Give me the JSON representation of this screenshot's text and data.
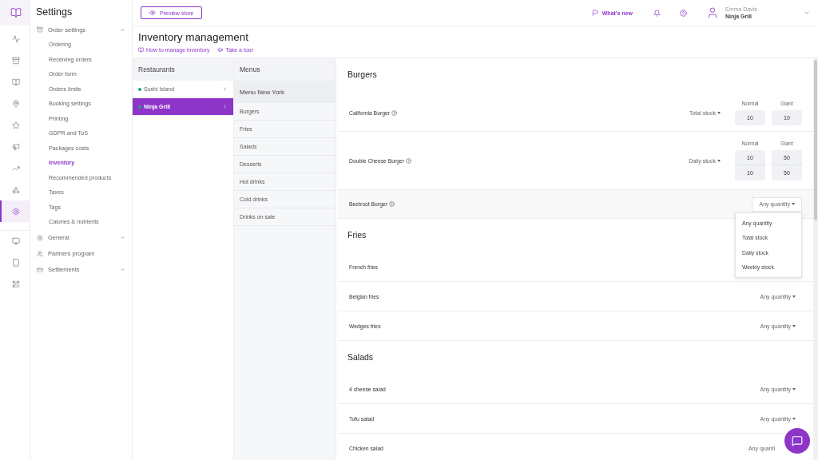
{
  "rail": [
    {
      "selected": false
    },
    {
      "selected": false
    },
    {
      "selected": false
    },
    {
      "selected": false
    },
    {
      "selected": false
    },
    {
      "selected": false
    },
    {
      "selected": false
    },
    {
      "selected": false
    },
    {
      "selected": false
    },
    {
      "selected": true
    },
    {
      "selected": false
    },
    {
      "selected": false
    },
    {
      "selected": false
    }
  ],
  "settings": {
    "title": "Settings",
    "groups": [
      {
        "label": "Order settings",
        "expandable": true,
        "expanded": true,
        "children": [
          {
            "label": "Ordering",
            "selected": false
          },
          {
            "label": "Receiving orders",
            "selected": false
          },
          {
            "label": "Order form",
            "selected": false
          },
          {
            "label": "Orders limits",
            "selected": false
          },
          {
            "label": "Booking settings",
            "selected": false
          },
          {
            "label": "Printing",
            "selected": false
          },
          {
            "label": "GDPR and ToS",
            "selected": false
          },
          {
            "label": "Packages costs",
            "selected": false
          },
          {
            "label": "Inventory",
            "selected": true
          },
          {
            "label": "Recommended products",
            "selected": false
          },
          {
            "label": "Taxes",
            "selected": false
          },
          {
            "label": "Tags",
            "selected": false
          },
          {
            "label": "Calories & nutrients",
            "selected": false
          }
        ]
      },
      {
        "label": "General",
        "expandable": true,
        "expanded": false
      },
      {
        "label": "Partners program",
        "expandable": false,
        "expanded": false
      },
      {
        "label": "Settlements",
        "expandable": true,
        "expanded": false
      }
    ]
  },
  "header": {
    "preview_button": "Preview store",
    "whats_new": "What's new",
    "user": {
      "name": "Emma Davis",
      "restaurant": "Ninja Grill"
    }
  },
  "page": {
    "title": "Inventory management",
    "links": [
      "How to manage inventory",
      "Take a tour"
    ]
  },
  "restaurants": {
    "title": "Restaurants",
    "items": [
      {
        "name": "Sushi Island",
        "color": "#1aa37a",
        "selected": false
      },
      {
        "name": "Ninja Grill",
        "color": "#1aa37a",
        "selected": true
      }
    ]
  },
  "menus": {
    "title": "Menus",
    "menu": "Menu New York",
    "categories": [
      "Burgers",
      "Fries",
      "Salads",
      "Desserts",
      "Hot drinks",
      "Cold drinks",
      "Drinks on sale"
    ]
  },
  "sections": [
    {
      "title": "Burgers",
      "items": [
        {
          "name": "California Burger",
          "help": true,
          "kind": "stock",
          "mode": "Total stock",
          "open": false,
          "columns": [
            "Normal",
            "Giant"
          ],
          "rows": [
            [
              "10",
              "10"
            ]
          ]
        },
        {
          "name": "Double Cheese Burger",
          "help": true,
          "kind": "stock",
          "mode": "Daily stock",
          "open": false,
          "columns": [
            "Normal",
            "Giant"
          ],
          "rows": [
            [
              "10",
              "50"
            ],
            [
              "10",
              "50"
            ]
          ]
        },
        {
          "name": "Beetroot Burger",
          "help": true,
          "kind": "select",
          "mode": "Any quantity",
          "open": true,
          "options": [
            "Any quantity",
            "Total stock",
            "Daily stock",
            "Weekly stock"
          ]
        }
      ]
    },
    {
      "title": "Fries",
      "items": [
        {
          "name": "French fries",
          "help": false,
          "kind": "plain"
        },
        {
          "name": "Belgian fries",
          "help": false,
          "kind": "select",
          "mode": "Any quantity",
          "open": false
        },
        {
          "name": "Wedges fries",
          "help": false,
          "kind": "select",
          "mode": "Any quantity",
          "open": false
        }
      ]
    },
    {
      "title": "Salads",
      "items": [
        {
          "name": "4 cheese salad",
          "help": false,
          "kind": "select",
          "mode": "Any quantity",
          "open": false
        },
        {
          "name": "Tofu salad",
          "help": false,
          "kind": "select",
          "mode": "Any quantity",
          "open": false
        },
        {
          "name": "Chicken salad",
          "help": false,
          "kind": "covered",
          "mode": "Any quanti",
          "open": false
        }
      ]
    }
  ]
}
